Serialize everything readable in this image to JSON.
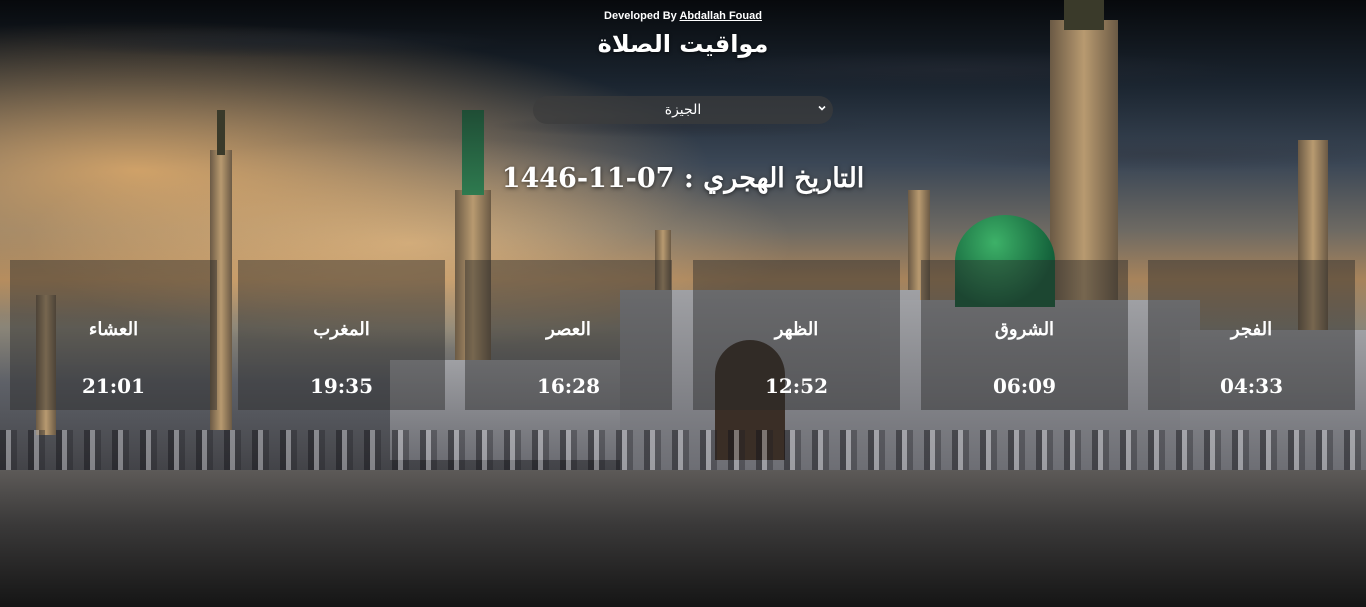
{
  "header": {
    "credit_prefix": "Developed By",
    "credit_name": "Abdallah Fouad",
    "title": "مواقيت الصلاة"
  },
  "city_select": {
    "selected": "الجيزة"
  },
  "hijri_date": {
    "label": "التاريخ الهجري :",
    "value": "1446-11-07"
  },
  "prayers": [
    {
      "name": "العشاء",
      "time": "21:01"
    },
    {
      "name": "المغرب",
      "time": "19:35"
    },
    {
      "name": "العصر",
      "time": "16:28"
    },
    {
      "name": "الظهر",
      "time": "12:52"
    },
    {
      "name": "الشروق",
      "time": "06:09"
    },
    {
      "name": "الفجر",
      "time": "04:33"
    }
  ]
}
